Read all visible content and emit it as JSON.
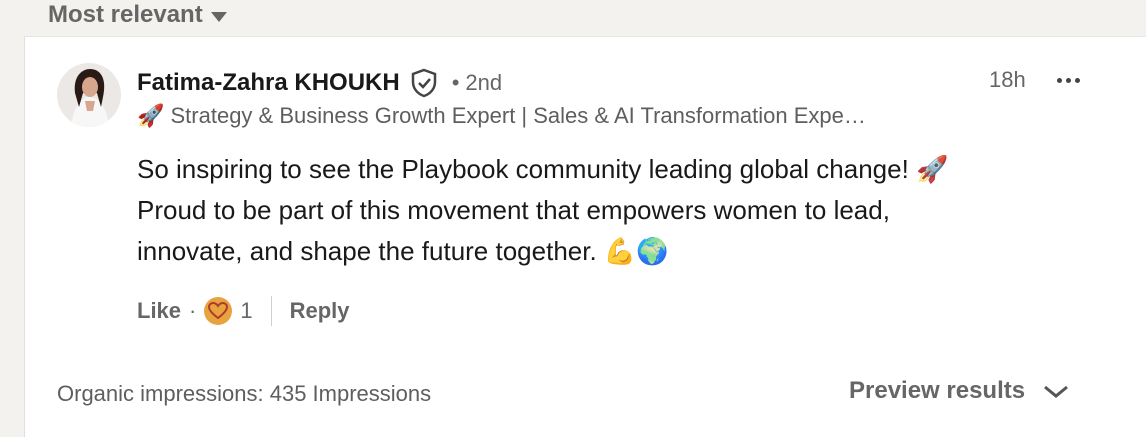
{
  "sort": {
    "label": "Most relevant"
  },
  "comment": {
    "author": "Fatima-Zahra KHOUKH",
    "degree": "2nd",
    "headline": "🚀 Strategy & Business Growth Expert | Sales & AI Transformation Expe…",
    "time": "18h",
    "text_lines": [
      "So inspiring to see the Playbook community leading global change! 🚀",
      " Proud to be part of this movement that empowers women to lead,",
      "innovate, and shape the future together. 💪🌍"
    ],
    "like_label": "Like",
    "reaction_count": "1",
    "reply_label": "Reply"
  },
  "footer": {
    "impressions": "Organic impressions: 435 Impressions",
    "preview_label": "Preview results"
  },
  "icons": [
    "verified-shield-icon",
    "more-options-icon",
    "love-reaction-icon",
    "chevron-down-icon",
    "caret-down-icon"
  ],
  "colors": {
    "muted": "#666666",
    "reaction": "#e7a33e",
    "background": "#f4f2ee"
  }
}
